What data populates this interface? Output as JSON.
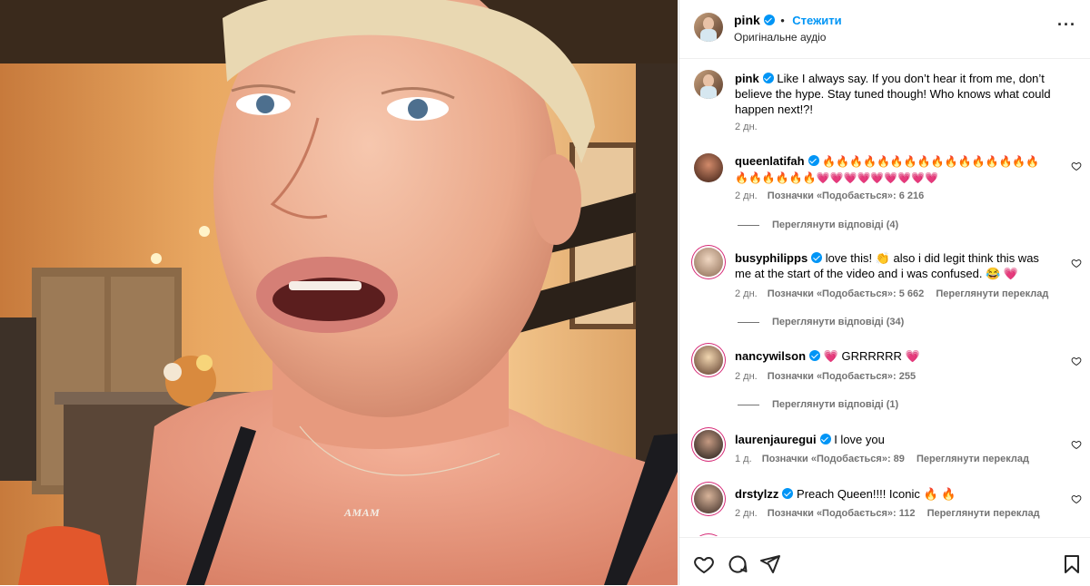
{
  "post": {
    "username": "pink",
    "follow_label": "Стежити",
    "audio_label": "Оригінальне аудіо",
    "caption": "Like I always say. If you don’t hear it from me, don’t believe the hype. Stay tuned though! Who knows what could happen next!?!",
    "time": "2 дн.",
    "necklace_text": "AMAM"
  },
  "comments": [
    {
      "username": "queenlatifah",
      "line1": "🔥🔥🔥🔥🔥🔥🔥🔥🔥🔥🔥🔥🔥🔥🔥🔥",
      "line2": "🔥🔥🔥🔥🔥🔥💗💗💗💗💗💗💗💗💗",
      "time": "2 дн.",
      "likes": "Позначки «Подобається»: 6 216",
      "replies": "Переглянути відповіді (4)"
    },
    {
      "username": "busyphilipps",
      "text": "love this! 👏 also i did legit think this was me at the start of the video and i was confused. 😂 💗",
      "time": "2 дн.",
      "likes": "Позначки «Подобається»: 5 662",
      "translate": "Переглянути переклад",
      "replies": "Переглянути відповіді (34)"
    },
    {
      "username": "nancywilson",
      "text": "💗 GRRRRRR 💗",
      "time": "2 дн.",
      "likes": "Позначки «Подобається»: 255",
      "replies": "Переглянути відповіді (1)"
    },
    {
      "username": "laurenjauregui",
      "text": "I love you",
      "time": "1 д.",
      "likes": "Позначки «Подобається»: 89",
      "translate": "Переглянути переклад"
    },
    {
      "username": "drstylzz",
      "text": "Preach Queen!!!! Iconic 🔥 🔥",
      "time": "2 дн.",
      "likes": "Позначки «Подобається»: 112",
      "translate": "Переглянути переклад"
    }
  ],
  "icons": {
    "like": "heart-icon",
    "comment": "comment-icon",
    "share": "share-icon",
    "save": "bookmark-icon",
    "more": "more-options-icon"
  },
  "colors": {
    "accent": "#0095f6",
    "muted": "#737373"
  }
}
